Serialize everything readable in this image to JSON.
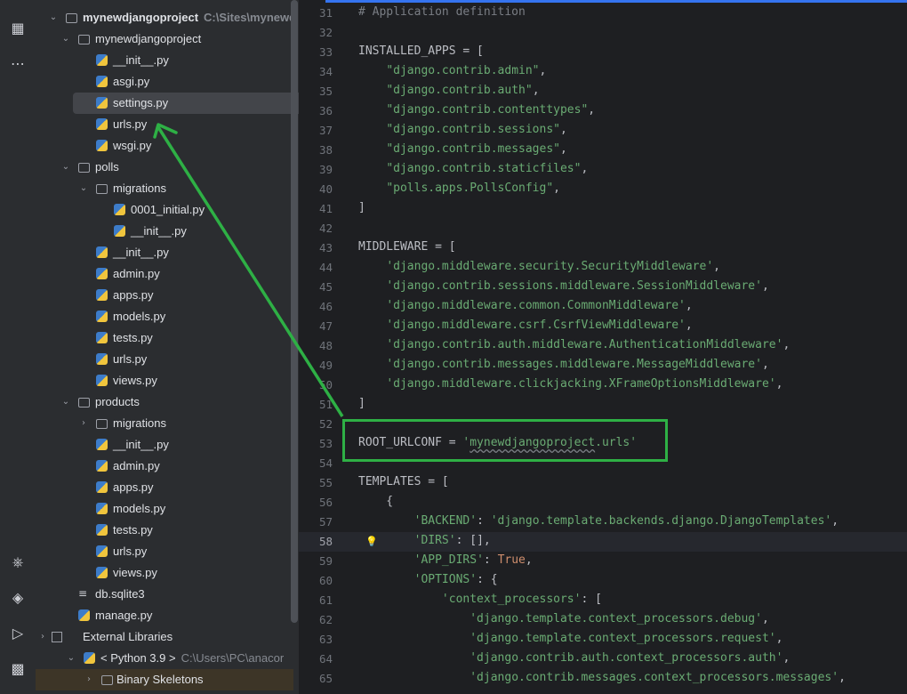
{
  "sidebar": {
    "root": {
      "label": "mynewdjangoproject",
      "path": "C:\\Sites\\mynewd"
    },
    "items": [
      {
        "label": "mynewdjangoproject",
        "type": "folder",
        "level": 1,
        "expanded": true
      },
      {
        "label": "__init__.py",
        "type": "py",
        "level": 2
      },
      {
        "label": "asgi.py",
        "type": "py",
        "level": 2
      },
      {
        "label": "settings.py",
        "type": "py",
        "level": 2,
        "selected": true
      },
      {
        "label": "urls.py",
        "type": "py",
        "level": 2
      },
      {
        "label": "wsgi.py",
        "type": "py",
        "level": 2
      },
      {
        "label": "polls",
        "type": "folder",
        "level": 1,
        "expanded": true
      },
      {
        "label": "migrations",
        "type": "folder",
        "level": 2,
        "expanded": true
      },
      {
        "label": "0001_initial.py",
        "type": "py",
        "level": 3
      },
      {
        "label": "__init__.py",
        "type": "py",
        "level": 3
      },
      {
        "label": "__init__.py",
        "type": "py",
        "level": 2
      },
      {
        "label": "admin.py",
        "type": "py",
        "level": 2
      },
      {
        "label": "apps.py",
        "type": "py",
        "level": 2
      },
      {
        "label": "models.py",
        "type": "py",
        "level": 2
      },
      {
        "label": "tests.py",
        "type": "py",
        "level": 2
      },
      {
        "label": "urls.py",
        "type": "py",
        "level": 2
      },
      {
        "label": "views.py",
        "type": "py",
        "level": 2
      },
      {
        "label": "products",
        "type": "folder",
        "level": 1,
        "expanded": true
      },
      {
        "label": "migrations",
        "type": "folder",
        "level": 2,
        "expanded": false
      },
      {
        "label": "__init__.py",
        "type": "py",
        "level": 2
      },
      {
        "label": "admin.py",
        "type": "py",
        "level": 2
      },
      {
        "label": "apps.py",
        "type": "py",
        "level": 2
      },
      {
        "label": "models.py",
        "type": "py",
        "level": 2
      },
      {
        "label": "tests.py",
        "type": "py",
        "level": 2
      },
      {
        "label": "urls.py",
        "type": "py",
        "level": 2
      },
      {
        "label": "views.py",
        "type": "py",
        "level": 2
      },
      {
        "label": "db.sqlite3",
        "type": "db",
        "level": 1
      },
      {
        "label": "manage.py",
        "type": "py",
        "level": 1
      }
    ],
    "external": {
      "label": "External Libraries"
    },
    "python": {
      "label": "< Python 3.9 >",
      "path": "C:\\Users\\PC\\anacor"
    },
    "skeletons": {
      "label": "Binary Skeletons"
    }
  },
  "activity_icons": [
    "structure-icon",
    "more-icon",
    "python-console-icon",
    "layers-icon",
    "run-icon",
    "terminal-icon"
  ],
  "editor": {
    "current_line": 58,
    "lines": [
      {
        "n": 31,
        "text": "# Application definition",
        "kind": "comment"
      },
      {
        "n": 32,
        "text": ""
      },
      {
        "n": 33,
        "text": "INSTALLED_APPS = ["
      },
      {
        "n": 34,
        "text": "    \"django.contrib.admin\","
      },
      {
        "n": 35,
        "text": "    \"django.contrib.auth\","
      },
      {
        "n": 36,
        "text": "    \"django.contrib.contenttypes\","
      },
      {
        "n": 37,
        "text": "    \"django.contrib.sessions\","
      },
      {
        "n": 38,
        "text": "    \"django.contrib.messages\","
      },
      {
        "n": 39,
        "text": "    \"django.contrib.staticfiles\","
      },
      {
        "n": 40,
        "text": "    \"polls.apps.PollsConfig\","
      },
      {
        "n": 41,
        "text": "]"
      },
      {
        "n": 42,
        "text": ""
      },
      {
        "n": 43,
        "text": "MIDDLEWARE = ["
      },
      {
        "n": 44,
        "text": "    'django.middleware.security.SecurityMiddleware',"
      },
      {
        "n": 45,
        "text": "    'django.contrib.sessions.middleware.SessionMiddleware',"
      },
      {
        "n": 46,
        "text": "    'django.middleware.common.CommonMiddleware',"
      },
      {
        "n": 47,
        "text": "    'django.middleware.csrf.CsrfViewMiddleware',"
      },
      {
        "n": 48,
        "text": "    'django.contrib.auth.middleware.AuthenticationMiddleware',"
      },
      {
        "n": 49,
        "text": "    'django.contrib.messages.middleware.MessageMiddleware',"
      },
      {
        "n": 50,
        "text": "    'django.middleware.clickjacking.XFrameOptionsMiddleware',"
      },
      {
        "n": 51,
        "text": "]"
      },
      {
        "n": 52,
        "text": ""
      },
      {
        "n": 53,
        "text": "ROOT_URLCONF = 'mynewdjangoproject.urls'"
      },
      {
        "n": 54,
        "text": ""
      },
      {
        "n": 55,
        "text": "TEMPLATES = ["
      },
      {
        "n": 56,
        "text": "    {"
      },
      {
        "n": 57,
        "text": "        'BACKEND': 'django.template.backends.django.DjangoTemplates',"
      },
      {
        "n": 58,
        "text": "        'DIRS': [],"
      },
      {
        "n": 59,
        "text": "        'APP_DIRS': True,"
      },
      {
        "n": 60,
        "text": "        'OPTIONS': {"
      },
      {
        "n": 61,
        "text": "            'context_processors': ["
      },
      {
        "n": 62,
        "text": "                'django.template.context_processors.debug',"
      },
      {
        "n": 63,
        "text": "                'django.template.context_processors.request',"
      },
      {
        "n": 64,
        "text": "                'django.contrib.auth.context_processors.auth',"
      },
      {
        "n": 65,
        "text": "                'django.contrib.messages.context_processors.messages',"
      }
    ]
  },
  "colors": {
    "accent": "#3574f0",
    "annotation": "#2eb045",
    "string": "#6aab73",
    "keyword": "#cf8e6d"
  }
}
